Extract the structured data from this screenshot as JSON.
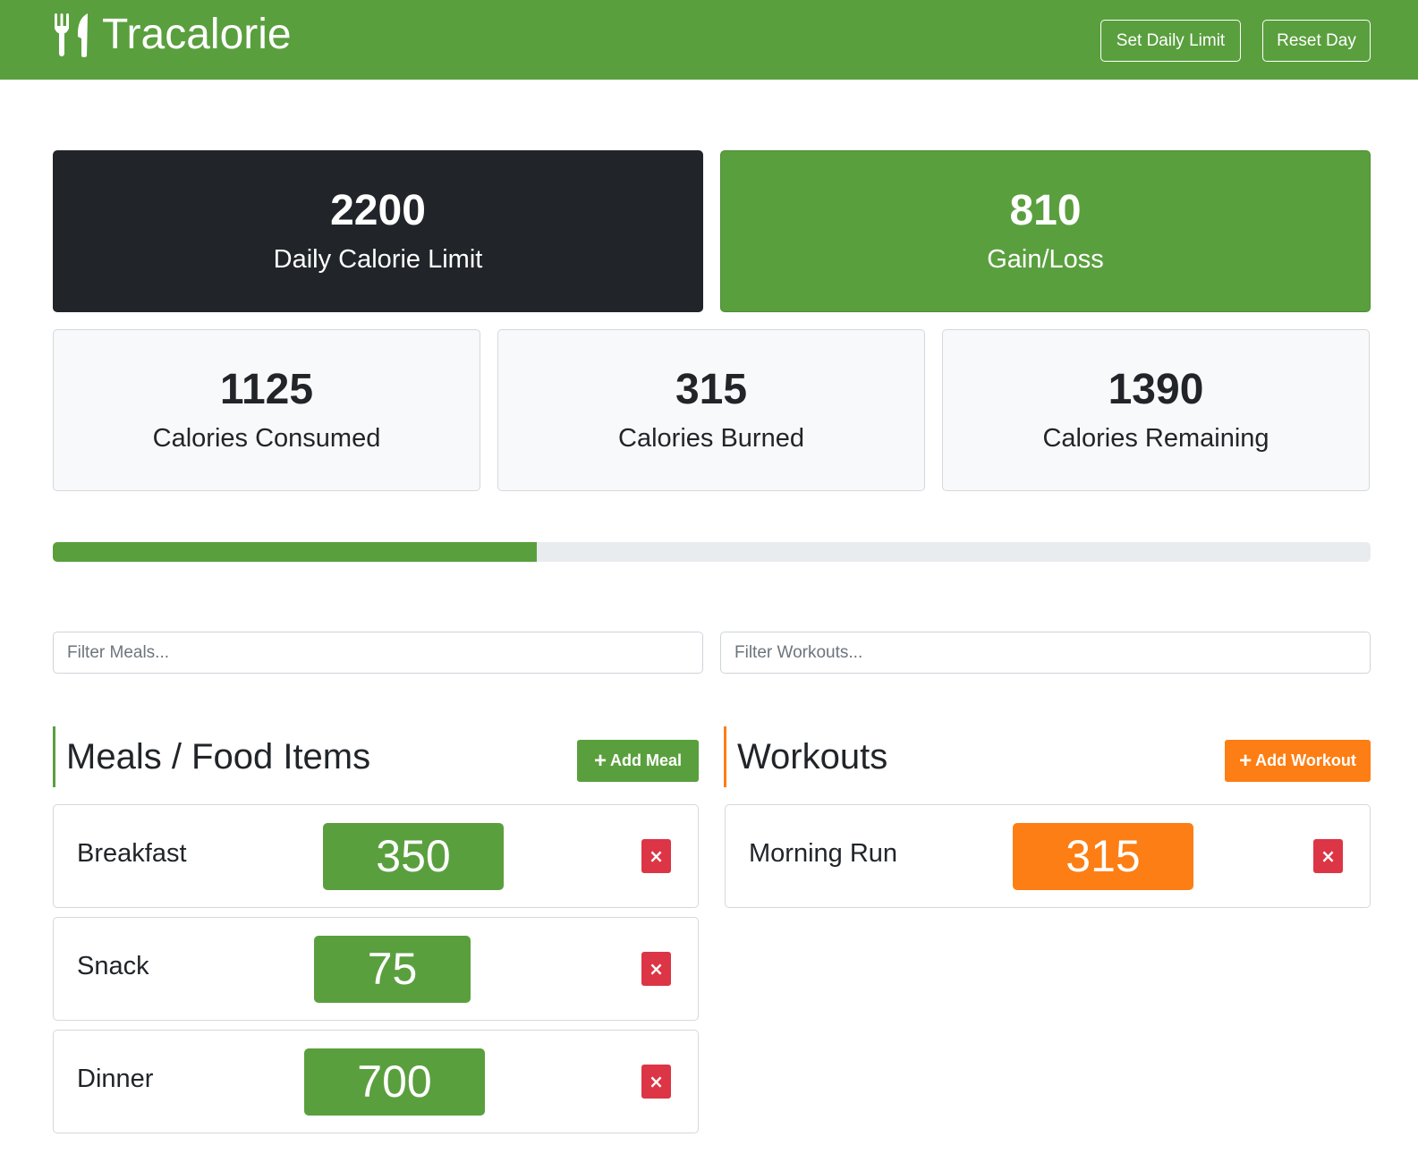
{
  "app": {
    "title": "Tracalorie",
    "brand_icon": "utensils-icon"
  },
  "navbar": {
    "set_limit_label": "Set Daily Limit",
    "reset_label": "Reset Day"
  },
  "stats": {
    "daily_limit": {
      "value": "2200",
      "label": "Daily Calorie Limit"
    },
    "gain_loss": {
      "value": "810",
      "label": "Gain/Loss"
    },
    "consumed": {
      "value": "1125",
      "label": "Calories Consumed"
    },
    "burned": {
      "value": "315",
      "label": "Calories Burned"
    },
    "remaining": {
      "value": "1390",
      "label": "Calories Remaining"
    }
  },
  "progress": {
    "fraction": 0.367
  },
  "filters": {
    "meals_placeholder": "Filter Meals...",
    "workouts_placeholder": "Filter Workouts..."
  },
  "meals": {
    "heading": "Meals / Food Items",
    "add_label": "Add Meal",
    "items": [
      {
        "name": "Breakfast",
        "calories": "350"
      },
      {
        "name": "Snack",
        "calories": "75"
      },
      {
        "name": "Dinner",
        "calories": "700"
      }
    ]
  },
  "workouts": {
    "heading": "Workouts",
    "add_label": "Add Workout",
    "items": [
      {
        "name": "Morning Run",
        "calories": "315"
      }
    ]
  },
  "colors": {
    "primary": "#5a9f3e",
    "dark": "#212529",
    "orange": "#fd7e14",
    "danger": "#dc3545"
  },
  "delete_icon": "×"
}
